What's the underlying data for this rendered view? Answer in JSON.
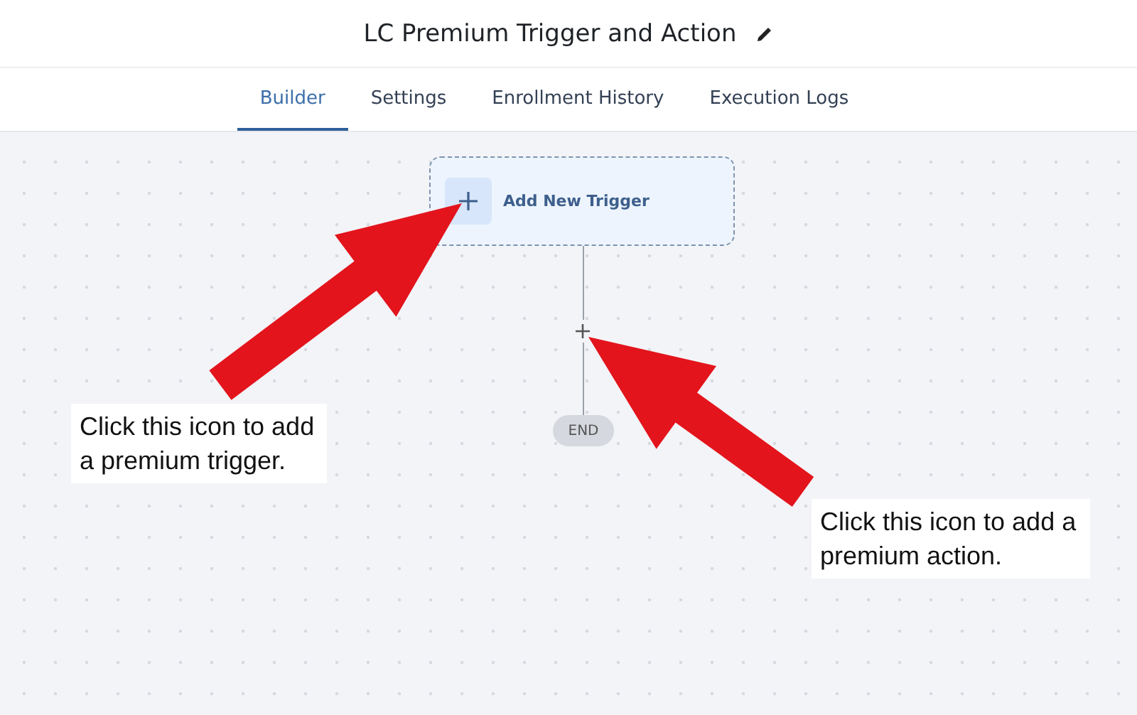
{
  "header": {
    "title": "LC Premium Trigger and Action"
  },
  "tabs": [
    {
      "label": "Builder",
      "selected": true
    },
    {
      "label": "Settings",
      "selected": false
    },
    {
      "label": "Enrollment History",
      "selected": false
    },
    {
      "label": "Execution Logs",
      "selected": false
    }
  ],
  "canvas": {
    "trigger_node": {
      "label": "Add New Trigger"
    },
    "end_node": {
      "label": "END"
    },
    "callouts": [
      {
        "text": "Click this icon to add a premium trigger.",
        "kind": "left"
      },
      {
        "text": "Click this icon to add a premium action.",
        "kind": "right"
      }
    ]
  }
}
